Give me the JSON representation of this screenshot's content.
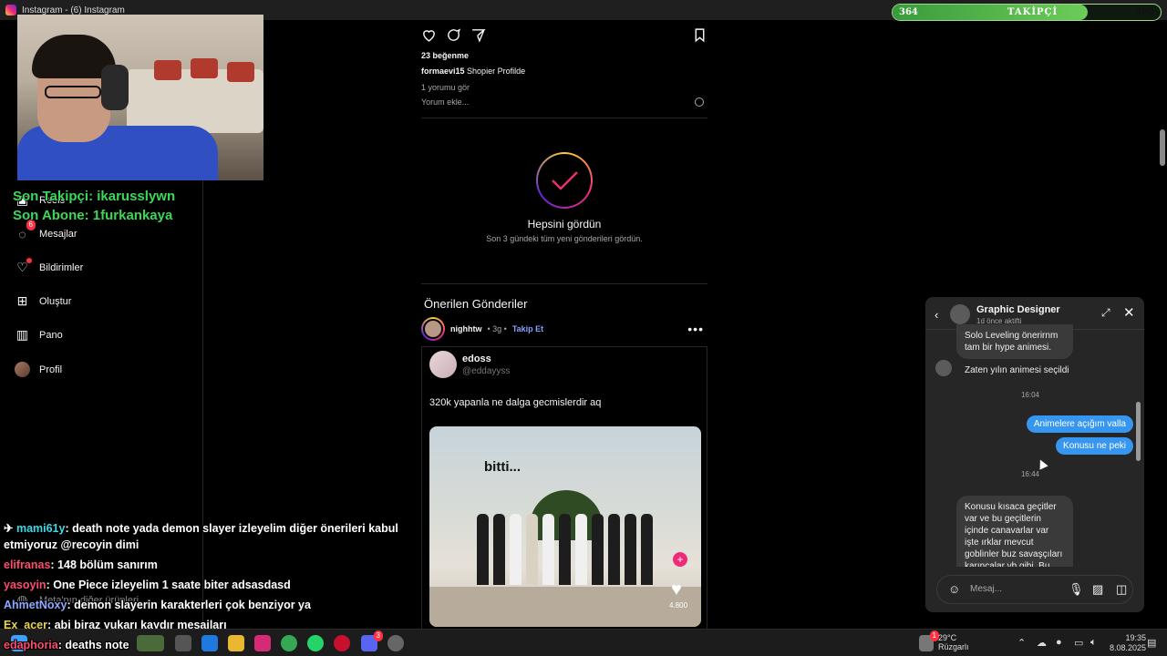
{
  "window": {
    "title": "Instagram - (6) Instagram"
  },
  "stream_overlay": {
    "follow_goal": {
      "current": "364",
      "label": "TAKİPÇİ",
      "target": "500",
      "progress": 0.728
    },
    "last_follower": "Son Takipçi: ikarusslywn",
    "last_subscriber": "Son Abone: 1furkankaya"
  },
  "sidebar": {
    "items": [
      {
        "label": "Reels",
        "icon": "reels-icon"
      },
      {
        "label": "Mesajlar",
        "icon": "messenger-icon",
        "badge": "6"
      },
      {
        "label": "Bildirimler",
        "icon": "heart-icon"
      },
      {
        "label": "Oluştur",
        "icon": "plus-square-icon"
      },
      {
        "label": "Pano",
        "icon": "dashboard-icon"
      },
      {
        "label": "Profil",
        "icon": "avatar"
      }
    ],
    "more_label": "Meta'nın diğer ürünleri"
  },
  "feed": {
    "post": {
      "likes": "23 beğenme",
      "caption_user": "formaevi15",
      "caption_text": "Shopier Profilde",
      "comments_link": "1 yorumu gör",
      "comment_placeholder": "Yorum ekle..."
    },
    "caught_up": {
      "title": "Hepsini gördün",
      "subtitle": "Son 3 gündeki tüm yeni gönderileri gördün."
    },
    "suggested_title": "Önerilen Gönderiler",
    "suggested_post": {
      "user": "nighhtw",
      "time": "• 3g •",
      "follow_label": "Takip Et",
      "tweet_name": "edoss",
      "tweet_handle": "@eddayyss",
      "tweet_text": "320k yapanla ne dalga gecmislerdir aq",
      "photo_caption": "bitti...",
      "photo_likes": "4.800"
    }
  },
  "chat": {
    "name": "Graphic Designer",
    "status": "1d önce aktifti",
    "messages": [
      {
        "dir": "in",
        "text": "Solo Leveling önerirnm tam bir hype animesi."
      },
      {
        "dir": "in",
        "text": "Zaten yılın animesi seçildi"
      },
      {
        "dir": "time",
        "text": "16:04"
      },
      {
        "dir": "out",
        "text": "Animelere açığım valla"
      },
      {
        "dir": "out",
        "text": "Konusu ne peki"
      },
      {
        "dir": "time",
        "text": "16:44"
      },
      {
        "dir": "in",
        "text": "Konusu kısaca geçitler var ve bu geçitlerin içinde canavarlar var işte ırklar mevcut goblinler buz savaşçıları karıncalar vb gibi. Bu dünyada e den s"
      }
    ],
    "input_placeholder": "Mesaj..."
  },
  "twitch_chat": [
    {
      "user": "mami61y",
      "color": "#3bd8e8",
      "text": ": death note yada demon slayer izleyelim diğer önerileri kabul"
    },
    {
      "user": "",
      "color": "#ffffff",
      "text": "etmiyoruz @recoyin dimi"
    },
    {
      "user": "elifranas",
      "color": "#ff4b6e",
      "text": ": 148 bölüm sanırım"
    },
    {
      "user": "yasoyin",
      "color": "#ff4b6e",
      "text": ": One Piece izleyelim 1 saate biter adsasdasd"
    },
    {
      "user": "AhmetNoxy",
      "color": "#8fa8ff",
      "text": ": demon slayerin karakterleri çok benziyor ya"
    },
    {
      "user": "Ex_acer",
      "color": "#e8d44d",
      "text": ": abi biraz yukarı kaydır mesajları"
    },
    {
      "user": "edaphoria",
      "color": "#ff4b6e",
      "text": ": deaths note"
    }
  ],
  "taskbar": {
    "weather_temp": "29°C",
    "weather_desc": "Rüzgarlı",
    "weather_badge": "1",
    "time": "19:35",
    "date": "8.08.2025",
    "discord_badge": "3"
  }
}
